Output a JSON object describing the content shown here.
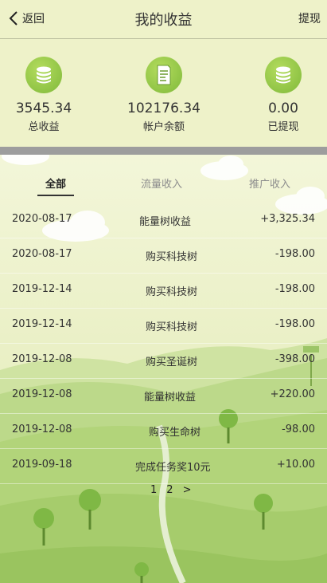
{
  "header": {
    "back_label": "返回",
    "title": "我的收益",
    "withdraw_label": "提现"
  },
  "stats": [
    {
      "value": "3545.34",
      "label": "总收益",
      "icon": "coin-stack-icon"
    },
    {
      "value": "102176.34",
      "label": "帐户余额",
      "icon": "receipt-icon"
    },
    {
      "value": "0.00",
      "label": "已提现",
      "icon": "coin-stack-icon"
    }
  ],
  "tabs": [
    {
      "label": "全部",
      "active": true
    },
    {
      "label": "流量收入",
      "active": false
    },
    {
      "label": "推广收入",
      "active": false
    }
  ],
  "records": [
    {
      "date": "2020-08-17",
      "desc": "能量树收益",
      "amount": "+3,325.34"
    },
    {
      "date": "2020-08-17",
      "desc": "购买科技树",
      "amount": "-198.00"
    },
    {
      "date": "2019-12-14",
      "desc": "购买科技树",
      "amount": "-198.00"
    },
    {
      "date": "2019-12-14",
      "desc": "购买科技树",
      "amount": "-198.00"
    },
    {
      "date": "2019-12-08",
      "desc": "购买圣诞树",
      "amount": "-398.00"
    },
    {
      "date": "2019-12-08",
      "desc": "能量树收益",
      "amount": "+220.00"
    },
    {
      "date": "2019-12-08",
      "desc": "购买生命树",
      "amount": "-98.00"
    },
    {
      "date": "2019-09-18",
      "desc": "完成任务奖10元",
      "amount": "+10.00"
    }
  ],
  "pagination": {
    "page1": "1",
    "page2": "2",
    "next": ">"
  },
  "colors": {
    "header_bg": "#eef2c9",
    "icon_green": "#8cc63f",
    "separator": "#9d9d9d"
  }
}
